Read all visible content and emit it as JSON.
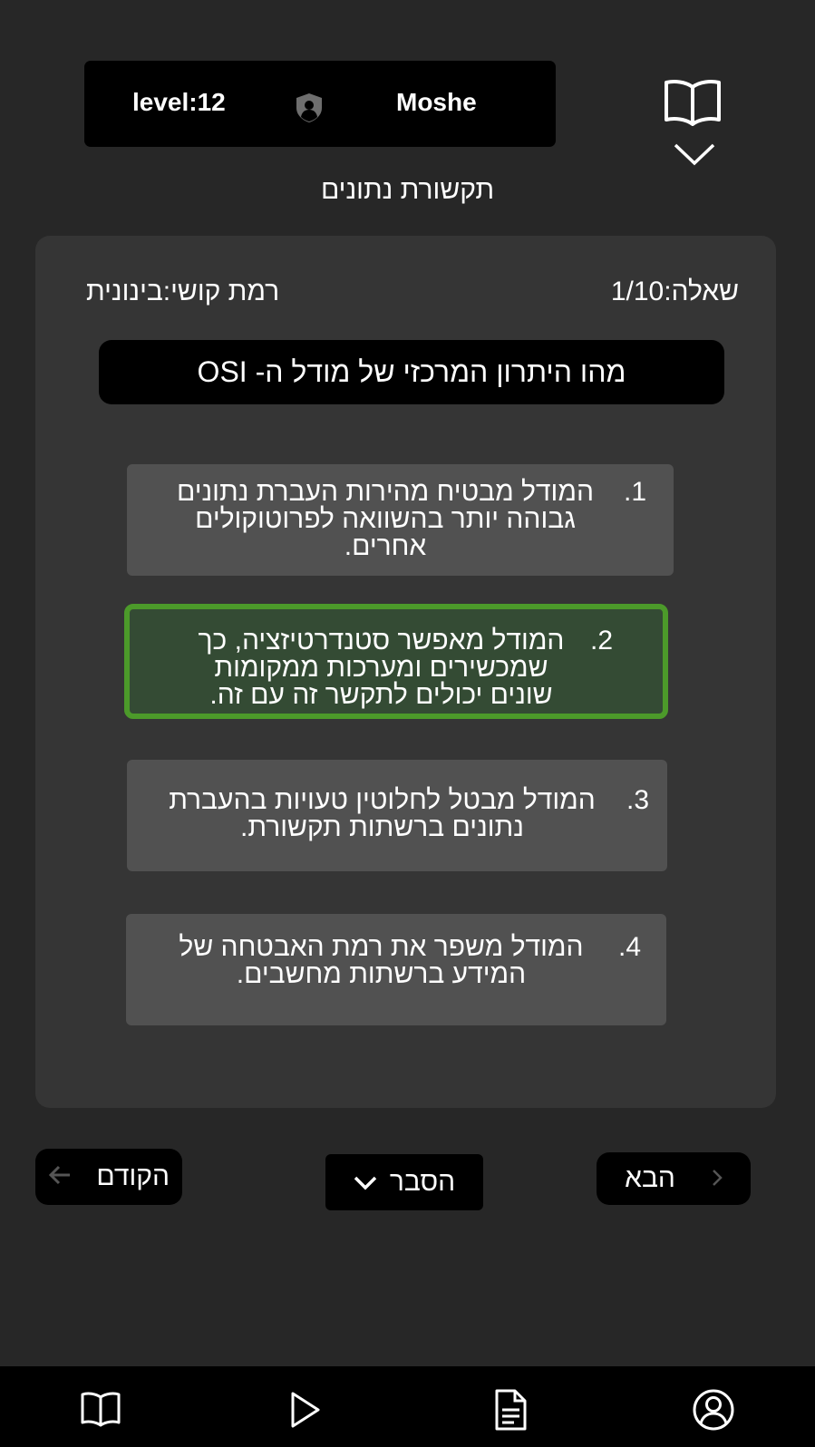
{
  "header": {
    "level_text": "level:12",
    "user_name": "Moshe",
    "subject": "תקשורת נתונים"
  },
  "quiz": {
    "question_counter": "שאלה:1/10",
    "difficulty": "רמת קושי:בינונית",
    "question": "מהו היתרון המרכזי של מודל ה- OSI",
    "answers": [
      {
        "number": "1.",
        "text": "המודל מבטיח מהירות העברת נתונים גבוהה יותר בהשוואה לפרוטוקולים אחרים.",
        "selected": false
      },
      {
        "number": "2.",
        "text": "המודל מאפשר סטנדרטיזציה, כך שמכשירים ומערכות ממקומות שונים יכולים לתקשר זה עם זה.",
        "selected": true
      },
      {
        "number": "3.",
        "text": "המודל מבטל לחלוטין טעויות בהעברת נתונים ברשתות תקשורת.",
        "selected": false
      },
      {
        "number": "4.",
        "text": "המודל משפר את רמת האבטחה של המידע ברשתות מחשבים.",
        "selected": false
      }
    ]
  },
  "buttons": {
    "prev_label": "הקודם",
    "explain_label": "הסבר",
    "next_label": "הבא"
  },
  "colors": {
    "background": "#272727",
    "panel": "#353535",
    "answer": "#515151",
    "selected_fill": "#344b34",
    "selected_border": "#4c9a2a"
  },
  "icons": {
    "user_badge": "shield-user-icon",
    "top_book": "book-icon",
    "top_chevron": "chevron-down-icon",
    "nav": [
      "book-icon",
      "play-icon",
      "document-icon",
      "profile-icon"
    ]
  }
}
